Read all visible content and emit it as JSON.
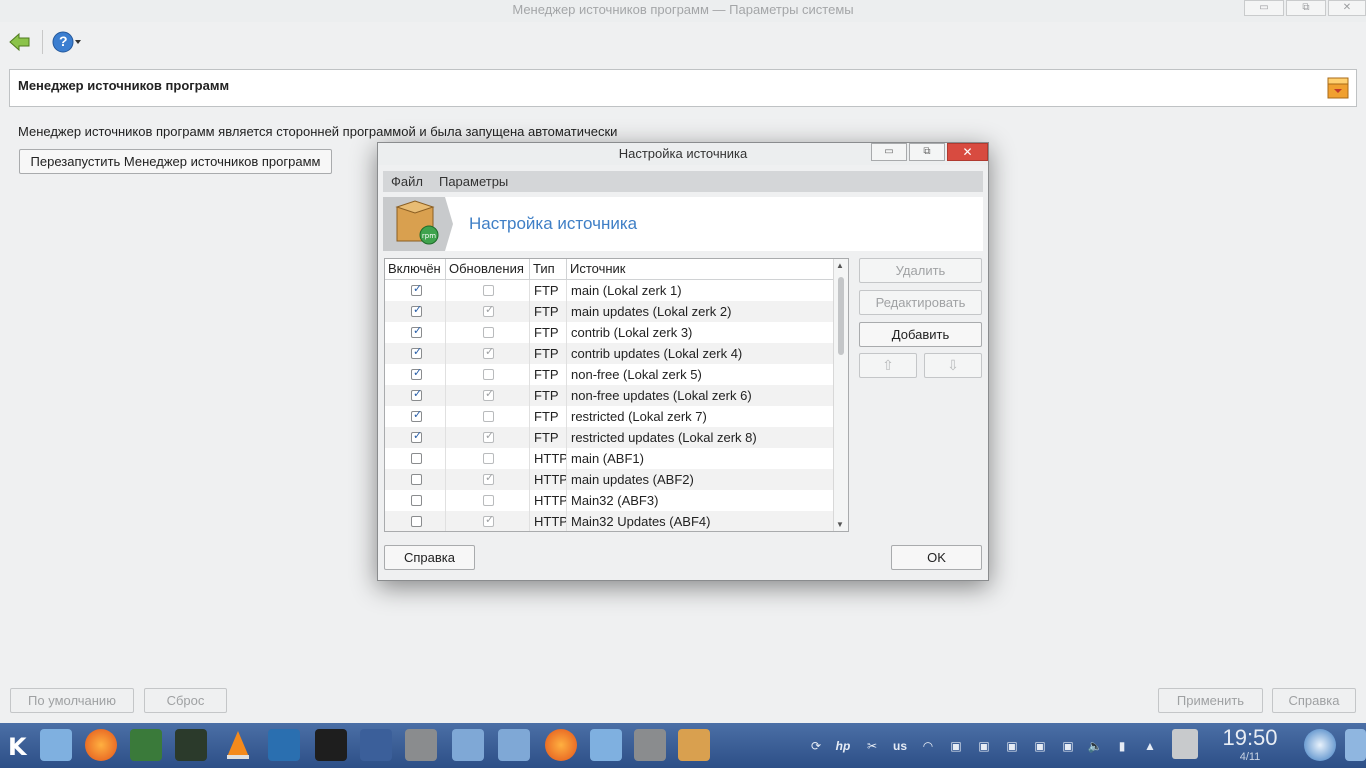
{
  "window": {
    "title": "Менеджер источников программ — Параметры системы",
    "buttons": [
      "▭",
      "⧉",
      "✕"
    ]
  },
  "toolbar": {
    "help_label": "?"
  },
  "header": {
    "title": "Менеджер источников программ"
  },
  "main": {
    "info_text": "Менеджер источников программ является сторонней программой и была запущена автоматически",
    "restart_label": "Перезапустить Менеджер источников программ"
  },
  "bottom": {
    "defaults_label": "По умолчанию",
    "reset_label": "Сброс",
    "apply_label": "Применить",
    "help_label": "Справка"
  },
  "dialog": {
    "title": "Настройка источника",
    "menu": [
      "Файл",
      "Параметры"
    ],
    "banner_title": "Настройка источника",
    "columns": [
      "Включён",
      "Обновления",
      "Тип",
      "Источник"
    ],
    "rows": [
      {
        "enabled": true,
        "updates": false,
        "type": "FTP",
        "source": "main (Lokal zerk 1)"
      },
      {
        "enabled": true,
        "updates": true,
        "type": "FTP",
        "source": "main updates (Lokal zerk 2)"
      },
      {
        "enabled": true,
        "updates": false,
        "type": "FTP",
        "source": "contrib (Lokal zerk 3)"
      },
      {
        "enabled": true,
        "updates": true,
        "type": "FTP",
        "source": "contrib updates (Lokal zerk 4)"
      },
      {
        "enabled": true,
        "updates": false,
        "type": "FTP",
        "source": "non-free (Lokal zerk 5)"
      },
      {
        "enabled": true,
        "updates": true,
        "type": "FTP",
        "source": "non-free updates (Lokal zerk 6)"
      },
      {
        "enabled": true,
        "updates": false,
        "type": "FTP",
        "source": "restricted (Lokal zerk 7)"
      },
      {
        "enabled": true,
        "updates": true,
        "type": "FTP",
        "source": "restricted updates (Lokal zerk 8)"
      },
      {
        "enabled": false,
        "updates": false,
        "type": "HTTP",
        "source": "main (ABF1)"
      },
      {
        "enabled": false,
        "updates": true,
        "type": "HTTP",
        "source": "main updates (ABF2)"
      },
      {
        "enabled": false,
        "updates": false,
        "type": "HTTP",
        "source": "Main32 (ABF3)"
      },
      {
        "enabled": false,
        "updates": true,
        "type": "HTTP",
        "source": "Main32 Updates (ABF4)"
      }
    ],
    "delete_label": "Удалить",
    "edit_label": "Редактировать",
    "add_label": "Добавить",
    "help_label": "Справка",
    "ok_label": "OK"
  },
  "taskbar": {
    "keyboard_layout": "us",
    "clock": "19:50",
    "date": "4/11"
  },
  "colors": {
    "accent": "#3f7fc6",
    "taskbar": "#3a5d95",
    "close_button": "#d84b40"
  }
}
